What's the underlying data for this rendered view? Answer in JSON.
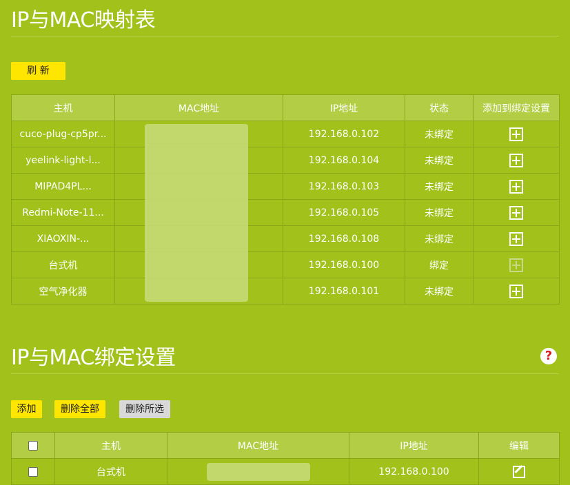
{
  "section1": {
    "title": "IP与MAC映射表",
    "refresh_label": "刷 新",
    "columns": [
      "主机",
      "MAC地址",
      "IP地址",
      "状态",
      "添加到绑定设置"
    ],
    "rows": [
      {
        "host": "cuco-plug-cp5pr...",
        "mac": "",
        "ip": "192.168.0.102",
        "status": "未绑定",
        "add_enabled": true
      },
      {
        "host": "yeelink-light-l...",
        "mac": "",
        "ip": "192.168.0.104",
        "status": "未绑定",
        "add_enabled": true
      },
      {
        "host": "MIPAD4PL...",
        "mac": "",
        "ip": "192.168.0.103",
        "status": "未绑定",
        "add_enabled": true
      },
      {
        "host": "Redmi-Note-11...",
        "mac": "",
        "ip": "192.168.0.105",
        "status": "未绑定",
        "add_enabled": true
      },
      {
        "host": "XIAOXIN-...",
        "mac": "",
        "ip": "192.168.0.108",
        "status": "未绑定",
        "add_enabled": true
      },
      {
        "host": "台式机",
        "mac": "",
        "ip": "192.168.0.100",
        "status": "绑定",
        "add_enabled": false
      },
      {
        "host": "空气净化器",
        "mac": "",
        "ip": "192.168.0.101",
        "status": "未绑定",
        "add_enabled": true
      }
    ]
  },
  "section2": {
    "title": "IP与MAC绑定设置",
    "help_glyph": "?",
    "add_label": "添加",
    "delete_all_label": "删除全部",
    "delete_selected_label": "删除所选",
    "columns": [
      "",
      "主机",
      "MAC地址",
      "IP地址",
      "编辑"
    ],
    "rows": [
      {
        "host": "台式机",
        "mac": "",
        "ip": "192.168.0.100"
      }
    ]
  },
  "colors": {
    "background": "#a2c21b",
    "header_bg": "#b3cd45",
    "button_yellow": "#ffe600",
    "button_gray": "#d9d9d9",
    "help_red": "#d61f1f"
  },
  "icons": {
    "add": "plus-square-icon",
    "edit": "edit-icon",
    "help": "help-icon"
  }
}
